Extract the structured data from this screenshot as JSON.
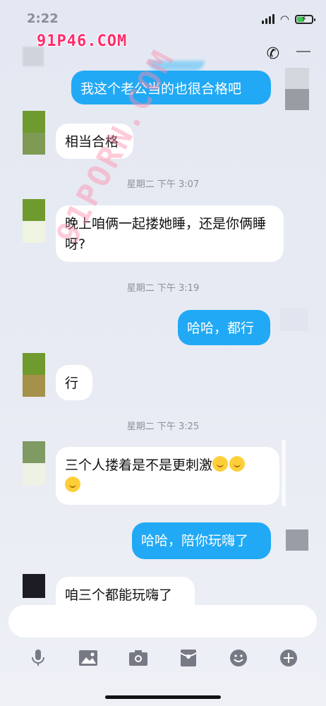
{
  "status_bar": {
    "time": "2:22"
  },
  "watermark": "91P46.COM",
  "diagonal_watermark": "91PORN.COM",
  "messages": [
    {
      "dir": "out",
      "text": "我这个老公当的也很合格吧"
    },
    {
      "dir": "in",
      "text": "相当合格"
    },
    {
      "dir": "in",
      "text": "晚上咱俩一起搂她睡，还是你俩睡呀?"
    },
    {
      "dir": "out",
      "text": "哈哈，都行"
    },
    {
      "dir": "in",
      "text": "行"
    },
    {
      "dir": "in",
      "text": "三个人搂着是不是更刺激"
    },
    {
      "dir": "out",
      "text": "哈哈，陪你玩嗨了"
    },
    {
      "dir": "in",
      "text": "咱三个都能玩嗨了"
    }
  ],
  "timestamps": [
    "星期二 下午 3:07",
    "星期二 下午 3:19",
    "星期二 下午 3:25"
  ],
  "toolbar": [
    "microphone-icon",
    "image-icon",
    "camera-icon",
    "red-packet-icon",
    "emoji-icon",
    "plus-icon"
  ],
  "colors": {
    "outgoing_bubble": "#21a9f5",
    "incoming_bubble": "#ffffff",
    "watermark": "#ff2b6b"
  }
}
